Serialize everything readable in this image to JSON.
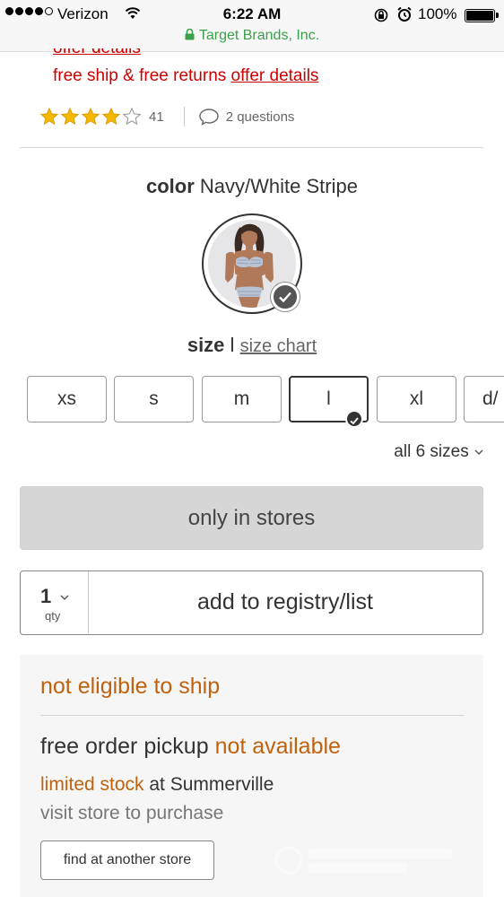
{
  "status_bar": {
    "carrier": "Verizon",
    "time": "6:22 AM",
    "battery": "100%",
    "url": "Target Brands, Inc."
  },
  "promo": {
    "cut_link": "offer details",
    "shipping_text": "free ship & free returns",
    "offer_link": "offer details"
  },
  "rating": {
    "stars": 4,
    "max_stars": 5,
    "count": "41",
    "questions": "2 questions"
  },
  "color": {
    "label": "color",
    "value": "Navy/White Stripe"
  },
  "size": {
    "label": "size",
    "separator": "l",
    "chart_link": "size chart",
    "options": [
      "xs",
      "s",
      "m",
      "l",
      "xl",
      "d/"
    ],
    "selected": "l",
    "all_sizes": "all 6 sizes"
  },
  "actions": {
    "stores_button": "only in stores",
    "qty_value": "1",
    "qty_label": "qty",
    "registry_button": "add to registry/list"
  },
  "fulfillment": {
    "ship_status": "not eligible to ship",
    "pickup_label": "free order pickup",
    "pickup_status": "not available",
    "stock_status": "limited stock",
    "stock_location": "at Summerville",
    "visit_text": "visit store to purchase",
    "find_button": "find at another store"
  },
  "colors": {
    "red_link": "#cc0000",
    "orange_status": "#c0620e",
    "star_gold": "#f5b800",
    "secure_green": "#3aa04a"
  }
}
